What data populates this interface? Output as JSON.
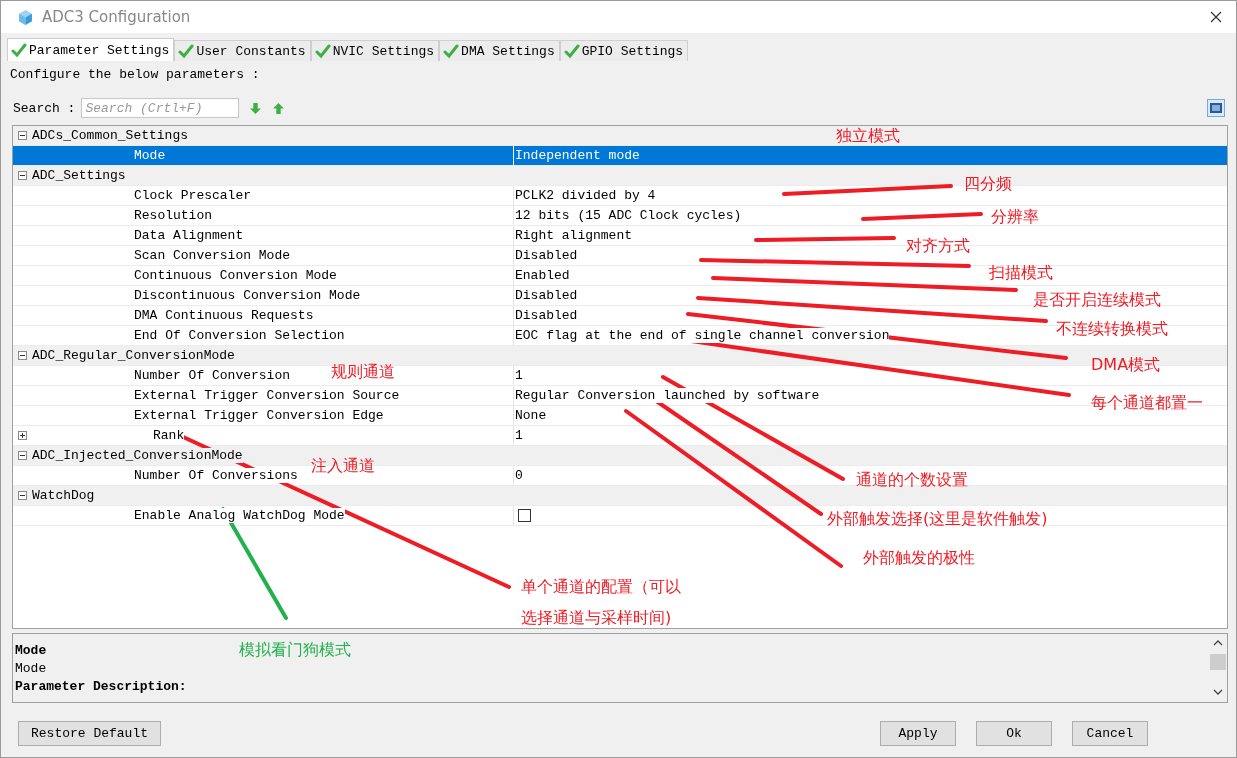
{
  "window": {
    "title": "ADC3 Configuration"
  },
  "tabs": [
    {
      "label": "Parameter Settings",
      "selected": true
    },
    {
      "label": "User Constants",
      "selected": false
    },
    {
      "label": "NVIC Settings",
      "selected": false
    },
    {
      "label": "DMA Settings",
      "selected": false
    },
    {
      "label": "GPIO Settings",
      "selected": false
    }
  ],
  "instructions": "Configure the below parameters :",
  "search": {
    "label": "Search :",
    "placeholder": "Search (Crtl+F)"
  },
  "groups": [
    {
      "label": "ADCs_Common_Settings",
      "expanded": true,
      "params": [
        {
          "label": "Mode",
          "value": "Independent mode",
          "selected": true,
          "kind": "text"
        }
      ]
    },
    {
      "label": "ADC_Settings",
      "expanded": true,
      "params": [
        {
          "label": "Clock Prescaler",
          "value": "PCLK2 divided by 4",
          "selected": false,
          "kind": "text"
        },
        {
          "label": "Resolution",
          "value": "12 bits (15 ADC Clock cycles)",
          "selected": false,
          "kind": "text"
        },
        {
          "label": "Data Alignment",
          "value": "Right alignment",
          "selected": false,
          "kind": "text"
        },
        {
          "label": "Scan Conversion Mode",
          "value": "Disabled",
          "selected": false,
          "kind": "text"
        },
        {
          "label": "Continuous Conversion Mode",
          "value": "Enabled",
          "selected": false,
          "kind": "text"
        },
        {
          "label": "Discontinuous Conversion Mode",
          "value": "Disabled",
          "selected": false,
          "kind": "text"
        },
        {
          "label": "DMA Continuous Requests",
          "value": "Disabled",
          "selected": false,
          "kind": "text"
        },
        {
          "label": "End Of Conversion Selection",
          "value": "EOC flag at the end of single channel conversion",
          "selected": false,
          "kind": "text"
        }
      ]
    },
    {
      "label": "ADC_Regular_ConversionMode",
      "expanded": true,
      "params": [
        {
          "label": "Number Of Conversion",
          "value": "1",
          "selected": false,
          "kind": "text"
        },
        {
          "label": "External Trigger Conversion Source",
          "value": "Regular Conversion launched by software",
          "selected": false,
          "kind": "text"
        },
        {
          "label": "External Trigger Conversion Edge",
          "value": "None",
          "selected": false,
          "kind": "text"
        },
        {
          "label": "Rank",
          "value": "1",
          "selected": false,
          "kind": "subgroup",
          "expanded": false
        }
      ]
    },
    {
      "label": "ADC_Injected_ConversionMode",
      "expanded": true,
      "params": [
        {
          "label": "Number Of Conversions",
          "value": "0",
          "selected": false,
          "kind": "text"
        }
      ]
    },
    {
      "label": "WatchDog",
      "expanded": true,
      "params": [
        {
          "label": "Enable Analog WatchDog Mode",
          "selected": false,
          "kind": "checkbox",
          "checked": false
        }
      ]
    }
  ],
  "description": {
    "title": "Mode",
    "name": "Mode",
    "heading": "Parameter Description:"
  },
  "buttons": {
    "restore": "Restore Default",
    "apply": "Apply",
    "ok": "Ok",
    "cancel": "Cancel"
  },
  "annotations": [
    {
      "text": "独立模式",
      "color": "#ee1c25"
    },
    {
      "text": "四分频",
      "color": "#ee1c25"
    },
    {
      "text": "分辨率",
      "color": "#ee1c25"
    },
    {
      "text": "对齐方式",
      "color": "#ee1c25"
    },
    {
      "text": "扫描模式",
      "color": "#ee1c25"
    },
    {
      "text": "是否开启连续模式",
      "color": "#ee1c25"
    },
    {
      "text": "不连续转换模式",
      "color": "#ee1c25"
    },
    {
      "text": "DMA模式",
      "color": "#ee1c25"
    },
    {
      "text": "每个通道都置一",
      "color": "#ee1c25"
    },
    {
      "text": "规则通道",
      "color": "#ee1c25"
    },
    {
      "text": "注入通道",
      "color": "#ee1c25"
    },
    {
      "text": "通道的个数设置",
      "color": "#ee1c25"
    },
    {
      "text": "外部触发选择(这里是软件触发)",
      "color": "#ee1c25"
    },
    {
      "text": "外部触发的极性",
      "color": "#ee1c25"
    },
    {
      "text": "单个通道的配置（可以选择通道与采样时间)",
      "color": "#ee1c25"
    },
    {
      "text": "模拟看门狗模式",
      "color": "#22b14c"
    }
  ]
}
